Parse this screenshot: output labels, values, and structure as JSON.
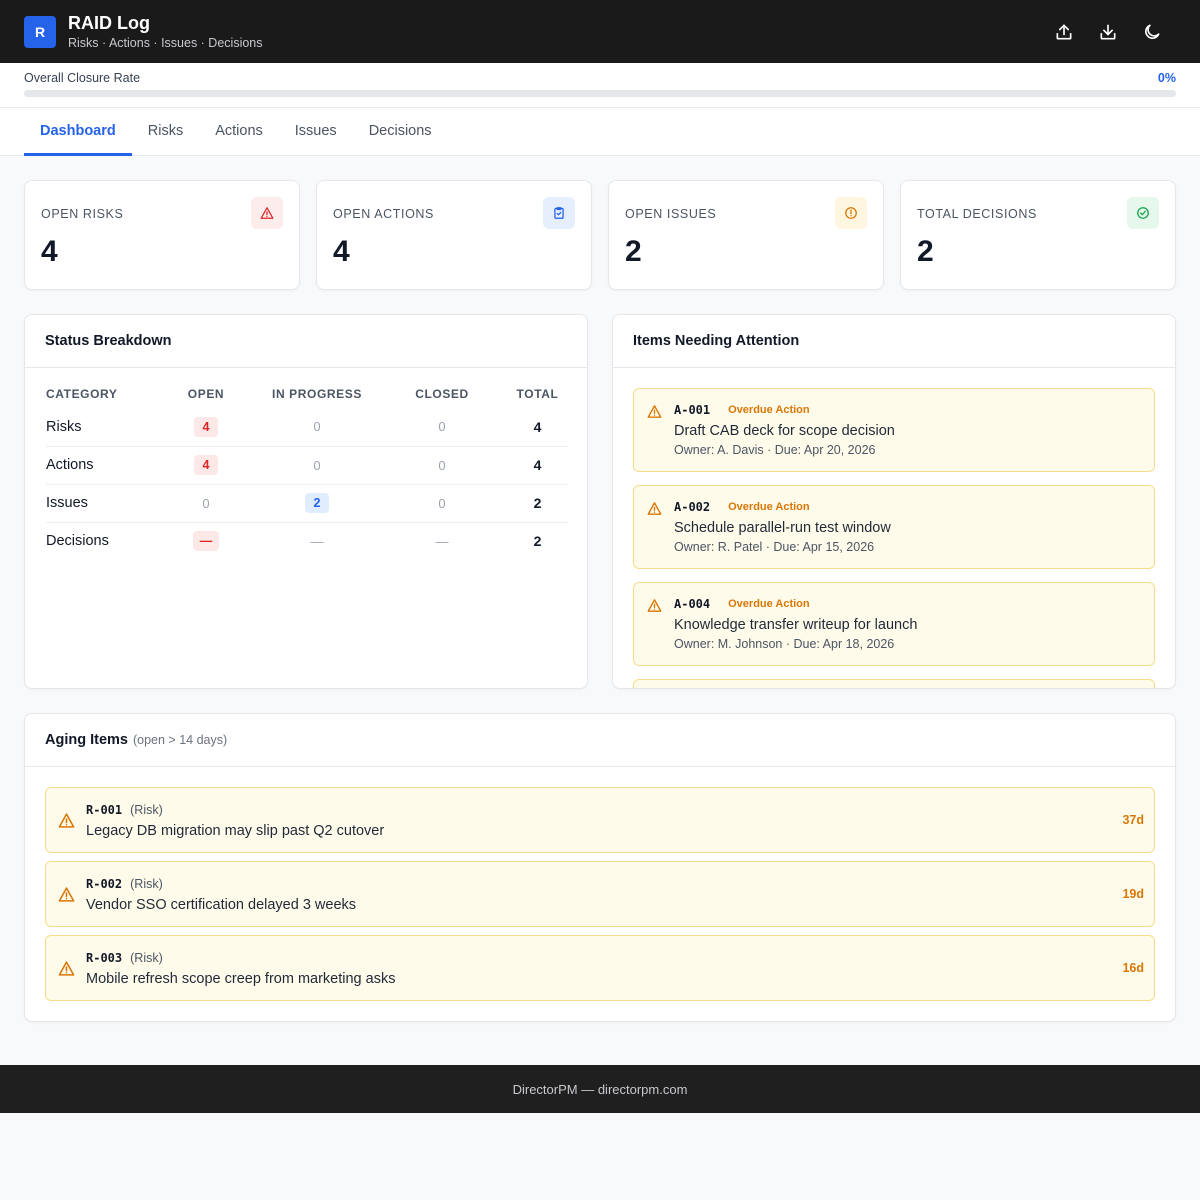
{
  "header": {
    "logo_letter": "R",
    "title": "RAID Log",
    "subtitle": "Risks · Actions · Issues · Decisions",
    "actions": [
      {
        "name": "upload-button",
        "icon": "upload-icon"
      },
      {
        "name": "download-button",
        "icon": "download-icon"
      },
      {
        "name": "theme-toggle-button",
        "icon": "moon-icon"
      }
    ]
  },
  "closure": {
    "label": "Overall Closure Rate",
    "value_text": "0%",
    "value": 0
  },
  "tabs": [
    {
      "label": "Dashboard",
      "active": true
    },
    {
      "label": "Risks",
      "active": false
    },
    {
      "label": "Actions",
      "active": false
    },
    {
      "label": "Issues",
      "active": false
    },
    {
      "label": "Decisions",
      "active": false
    }
  ],
  "stats": [
    {
      "label": "OPEN RISKS",
      "value": "4",
      "icon": "warning-triangle-icon",
      "color": "#dc2626",
      "bg": "#fdecec"
    },
    {
      "label": "OPEN ACTIONS",
      "value": "4",
      "icon": "clipboard-check-icon",
      "color": "#2563eb",
      "bg": "#e6efff"
    },
    {
      "label": "OPEN ISSUES",
      "value": "2",
      "icon": "alert-circle-icon",
      "color": "#d97706",
      "bg": "#fff6e0"
    },
    {
      "label": "TOTAL DECISIONS",
      "value": "2",
      "icon": "check-circle-icon",
      "color": "#16a34a",
      "bg": "#e6f7ec"
    }
  ],
  "status_breakdown": {
    "title": "Status Breakdown",
    "columns": [
      "CATEGORY",
      "OPEN",
      "IN PROGRESS",
      "CLOSED",
      "TOTAL"
    ],
    "rows": [
      {
        "category": "Risks",
        "open": "4",
        "in_progress": "0",
        "closed": "0",
        "total": "4"
      },
      {
        "category": "Actions",
        "open": "4",
        "in_progress": "0",
        "closed": "0",
        "total": "4"
      },
      {
        "category": "Issues",
        "open": "0",
        "in_progress": "2",
        "closed": "0",
        "total": "2"
      },
      {
        "category": "Decisions",
        "open": "—",
        "in_progress": "—",
        "closed": "—",
        "total": "2"
      }
    ]
  },
  "attention": {
    "title": "Items Needing Attention",
    "items": [
      {
        "id": "A-001",
        "tag": "Overdue Action",
        "title": "Draft CAB deck for scope decision",
        "meta": "Owner: A. Davis · Due: Apr 20, 2026"
      },
      {
        "id": "A-002",
        "tag": "Overdue Action",
        "title": "Schedule parallel-run test window",
        "meta": "Owner: R. Patel · Due: Apr 15, 2026"
      },
      {
        "id": "A-004",
        "tag": "Overdue Action",
        "title": "Knowledge transfer writeup for launch",
        "meta": "Owner: M. Johnson · Due: Apr 18, 2026"
      }
    ]
  },
  "aging": {
    "title": "Aging Items",
    "subtitle": "(open > 14 days)",
    "items": [
      {
        "id": "R-001",
        "kind": "(Risk)",
        "title": "Legacy DB migration may slip past Q2 cutover",
        "age": "37d"
      },
      {
        "id": "R-002",
        "kind": "(Risk)",
        "title": "Vendor SSO certification delayed 3 weeks",
        "age": "19d"
      },
      {
        "id": "R-003",
        "kind": "(Risk)",
        "title": "Mobile refresh scope creep from marketing asks",
        "age": "16d"
      }
    ]
  },
  "footer": {
    "text": "DirectorPM — directorpm.com"
  }
}
